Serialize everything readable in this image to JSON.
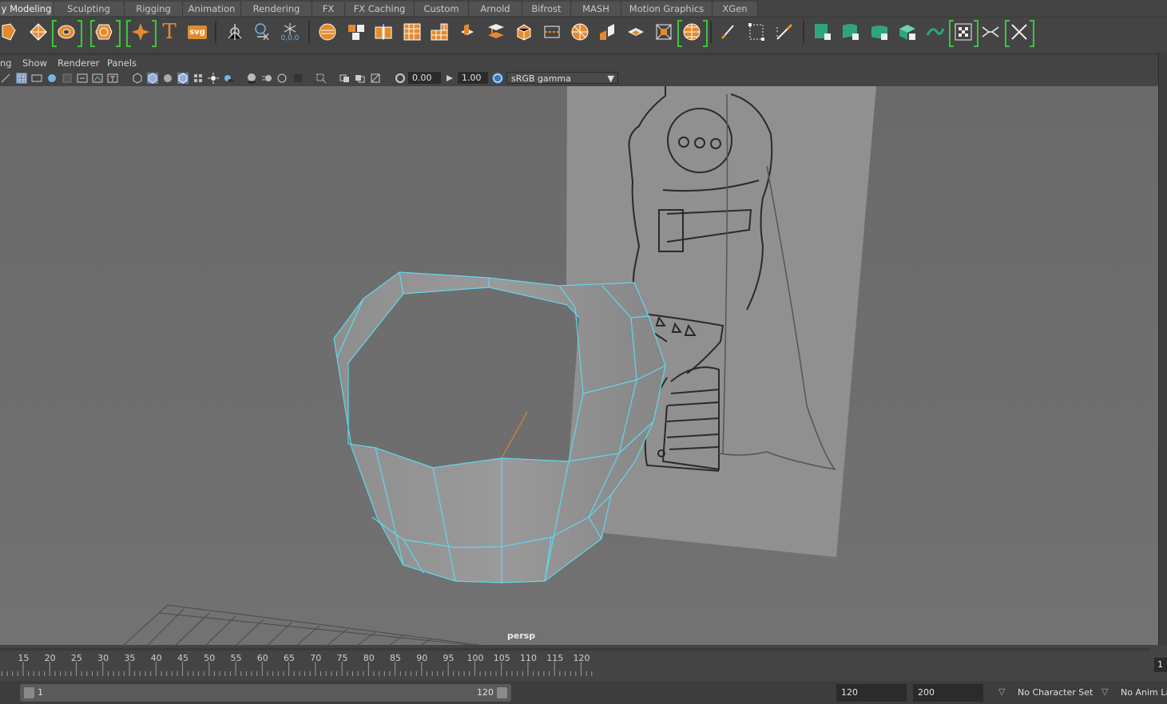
{
  "shelf_tabs": [
    {
      "label": "y Modeling",
      "active": true
    },
    {
      "label": "Sculpting"
    },
    {
      "label": "Rigging"
    },
    {
      "label": "Animation"
    },
    {
      "label": "Rendering"
    },
    {
      "label": "FX"
    },
    {
      "label": "FX Caching"
    },
    {
      "label": "Custom"
    },
    {
      "label": "Arnold"
    },
    {
      "label": "Bifrost"
    },
    {
      "label": "MASH"
    },
    {
      "label": "Motion Graphics"
    },
    {
      "label": "XGen"
    }
  ],
  "shelf_icons": {
    "text_tool_glyph": "T",
    "svg_tool_label": "svg",
    "reset_pivot_label": "0,0,0"
  },
  "panel_menu": {
    "lighting_cut": "ng",
    "show": "Show",
    "renderer": "Renderer",
    "panels": "Panels"
  },
  "panel_toolbar": {
    "exposure": "0.00",
    "gamma": "1.00",
    "colorspace": "sRGB gamma"
  },
  "viewport": {
    "camera_label": "persp"
  },
  "timeline": {
    "ticks": [
      "15",
      "20",
      "25",
      "30",
      "35",
      "40",
      "45",
      "50",
      "55",
      "60",
      "65",
      "70",
      "75",
      "80",
      "85",
      "90",
      "95",
      "100",
      "105",
      "110",
      "115",
      "120"
    ],
    "current_frame": "1"
  },
  "range": {
    "start": "1",
    "end": "120",
    "playback_end": "120",
    "anim_end": "200",
    "character_set": "No Character Set",
    "anim_layer": "No Anim La"
  },
  "colors": {
    "accent_orange": "#e38a2f",
    "selection_cyan": "#5fd8f0",
    "bracket_green": "#3fc43f",
    "poly_green": "#2fa67a"
  }
}
